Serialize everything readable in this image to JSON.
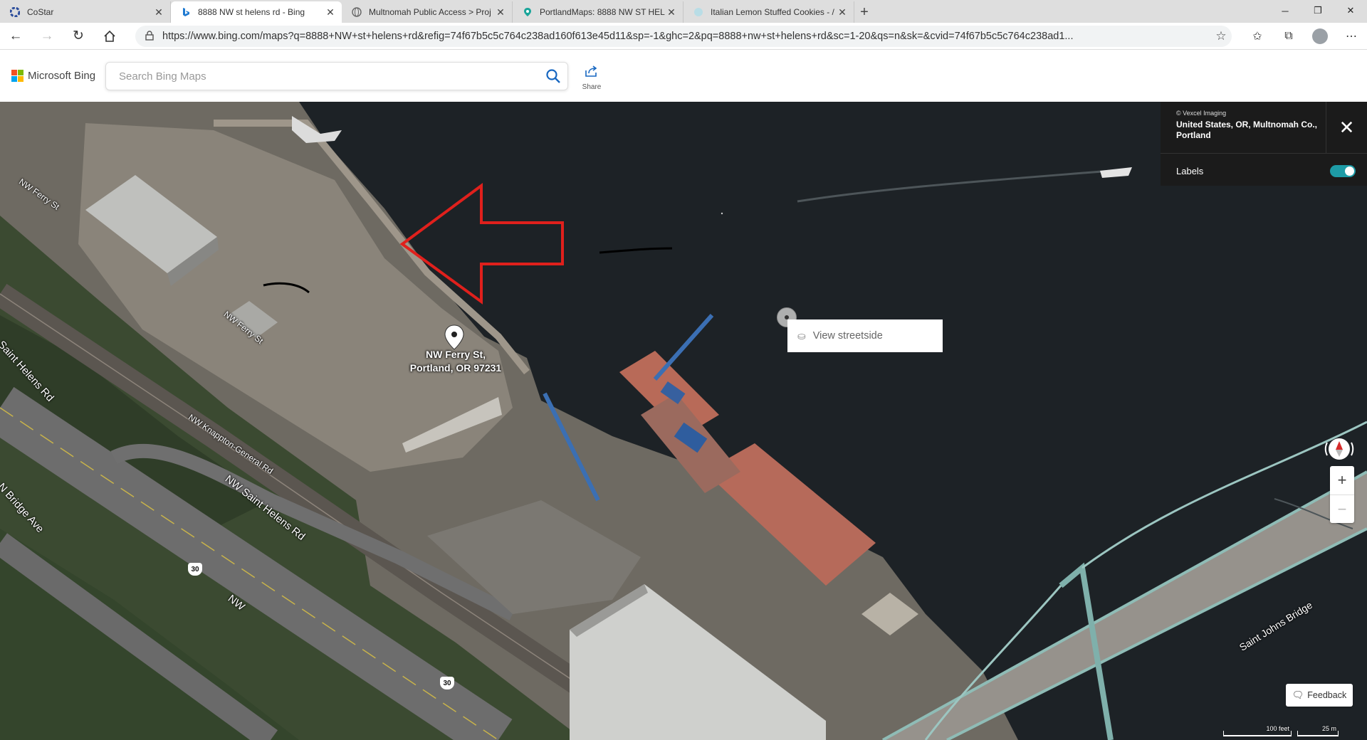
{
  "browser": {
    "tabs": [
      {
        "title": "CoStar",
        "icon": "costar-favicon",
        "active": false
      },
      {
        "title": "8888 NW st helens rd - Bing",
        "icon": "bing-favicon",
        "active": true
      },
      {
        "title": "Multnomah Public Access > Proj",
        "icon": "globe-favicon",
        "active": false
      },
      {
        "title": "PortlandMaps: 8888 NW ST HEL",
        "icon": "map-pin-favicon",
        "active": false
      },
      {
        "title": "Italian Lemon Stuffed Cookies - /",
        "icon": "cookie-favicon",
        "active": false
      }
    ],
    "url": "https://www.bing.com/maps?q=8888+NW+st+helens+rd&refig=74f67b5c5c764c238ad160f613e45d11&sp=-1&ghc=2&pq=8888+nw+st+helens+rd&sc=1-20&qs=n&sk=&cvid=74f67b5c5c764c238ad1..."
  },
  "bing": {
    "brand": "Microsoft Bing",
    "search_placeholder": "Search Bing Maps",
    "search_value": "",
    "share_label": "Share"
  },
  "map": {
    "imagery_credit": "© Vexcel Imaging",
    "location": "United States, OR, Multnomah Co., Portland",
    "labels_label": "Labels",
    "labels_on": true,
    "pin_line1": "NW Ferry St,",
    "pin_line2": "Portland, OR 97231",
    "streetside_label": "View streetside",
    "feedback_label": "Feedback",
    "scale_feet": "100 feet",
    "scale_meters": "25 m",
    "road_labels": {
      "ferry_st_1": "NW Ferry St",
      "ferry_st_2": "NW Ferry St",
      "saint_helens_1": "Saint Helens Rd",
      "saint_helens_2": "NW Saint Helens Rd",
      "knappton": "NW Knappton-General Rd",
      "bridge_ave": "N Bridge Ave",
      "saint_johns_bridge": "Saint Johns Bridge",
      "nw_partial": "NW",
      "shield_30_a": "30",
      "shield_30_b": "30"
    }
  }
}
